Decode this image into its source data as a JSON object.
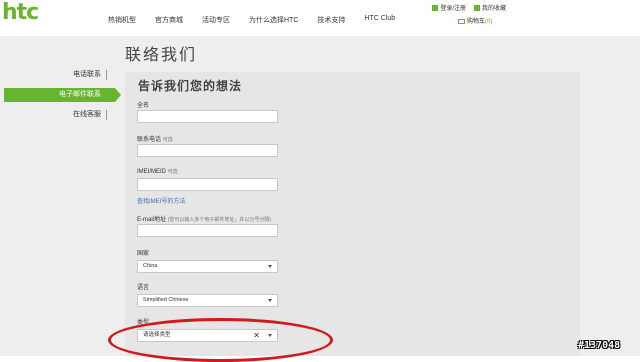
{
  "brand": {
    "logo_text": "htc",
    "accent": "#69b42e"
  },
  "nav": {
    "items": [
      "热销机型",
      "官方商城",
      "活动专区",
      "为什么选择HTC",
      "技术支持",
      "HTC Club"
    ]
  },
  "user": {
    "login": "登录/注册",
    "favorites": "我的收藏",
    "cart_label": "购物车",
    "cart_count": "(0)"
  },
  "page_title": "联络我们",
  "sidebar": {
    "items": [
      {
        "label": "电话联系",
        "active": false
      },
      {
        "label": "电子邮件联系",
        "active": true
      },
      {
        "label": "在线客服",
        "active": false
      }
    ]
  },
  "form": {
    "title": "告诉我们您的想法",
    "name_label": "全名",
    "phone_label": "联系电话",
    "phone_optional": "可选",
    "imei_label": "IMEI/MEID",
    "imei_optional": "可选",
    "imei_help": "查找IMEI号的方法",
    "email_label": "E-mail地址",
    "email_hint": "(您可以输入多个电子邮件地址，并以分号分隔)",
    "country_label": "国家",
    "country_value": "China",
    "language_label": "语言",
    "language_value": "Simplified Chinese",
    "type_label": "类型",
    "type_value": "请选择类型",
    "clear_glyph": "✕"
  },
  "annotation": {
    "color": "#d21a1a"
  },
  "watermark": "#137048"
}
